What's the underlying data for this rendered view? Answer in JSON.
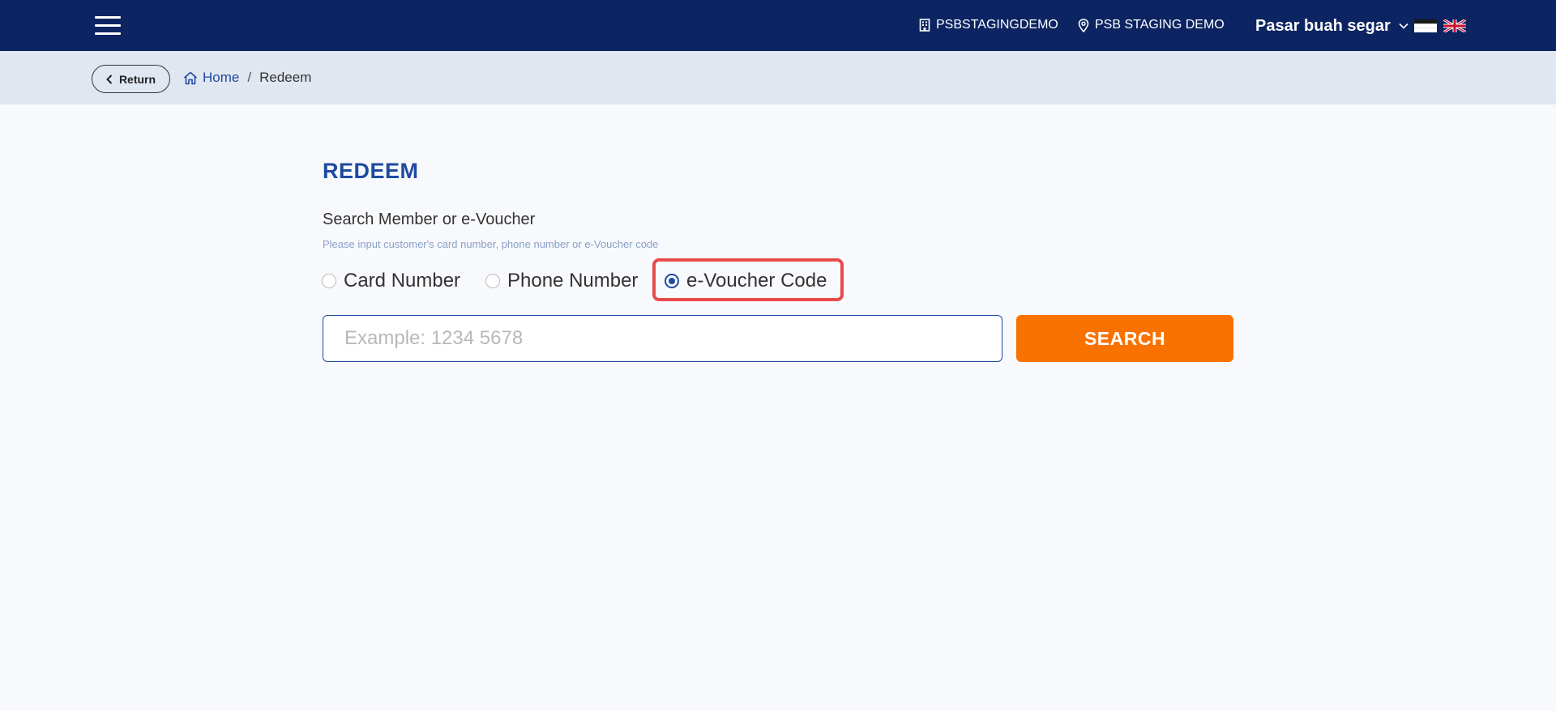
{
  "colors": {
    "navbar": "#0c2461",
    "breadcrumb_bar": "#e1e7f1",
    "accent": "#1f4aa0",
    "search_button": "#f97200",
    "highlight": "#e84a4a"
  },
  "header": {
    "menu_icon": "hamburger-icon",
    "company": {
      "icon": "building-icon",
      "label": "PSBSTAGINGDEMO"
    },
    "location": {
      "icon": "map-pin-icon",
      "label": "PSB STAGING DEMO"
    },
    "store": {
      "label": "Pasar buah segar",
      "icon": "chevron-down-icon"
    },
    "languages": [
      {
        "code": "id",
        "icon": "flag-indonesia-icon"
      },
      {
        "code": "en",
        "icon": "flag-uk-icon"
      }
    ]
  },
  "breadcrumb": {
    "return_label": "Return",
    "home_label": "Home",
    "separator": "/",
    "current": "Redeem"
  },
  "main": {
    "title": "REDEEM",
    "field_label": "Search Member or e-Voucher",
    "field_hint": "Please input customer's card number, phone number or e-Voucher code",
    "search_types": [
      {
        "label": "Card Number",
        "checked": false
      },
      {
        "label": "Phone Number",
        "checked": false
      },
      {
        "label": "e-Voucher Code",
        "checked": true
      }
    ],
    "search_input": {
      "value": "",
      "placeholder": "Example: 1234 5678"
    },
    "search_button": "SEARCH"
  }
}
